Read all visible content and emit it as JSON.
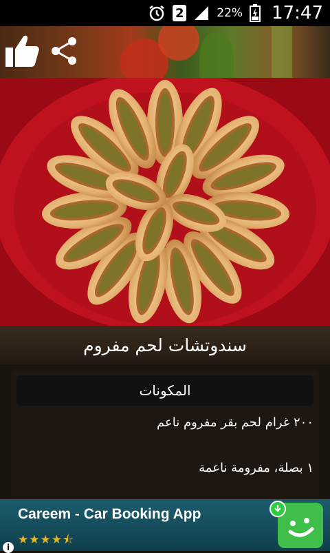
{
  "status_bar": {
    "battery_percent": "22%",
    "sim_slot": "2",
    "time": "17:47",
    "icons": [
      "alarm-icon",
      "sim-icon",
      "signal-icon",
      "battery-icon"
    ]
  },
  "toolbar": {
    "icons": [
      "thumbs-up-icon",
      "share-icon"
    ]
  },
  "recipe": {
    "title": "سندوتشات لحم مفروم",
    "section_title": "المكونات",
    "ingredients": [
      "٢٠٠ غرام لحم بقر مفروم ناعم",
      "١ بصلة، مفرومة ناعمة"
    ]
  },
  "ad": {
    "title": "Careem - Car Booking App",
    "rating_stars": "★★★★⯪",
    "info_label": "i",
    "icon": "careem-smile-icon",
    "download_icon": "download-icon"
  },
  "colors": {
    "status_bar_bg": "#000000",
    "plate_red": "#b8101c",
    "ad_bg": "#1c5d6e",
    "ad_icon_green": "#3fbf4a",
    "stars": "#e8b323"
  }
}
